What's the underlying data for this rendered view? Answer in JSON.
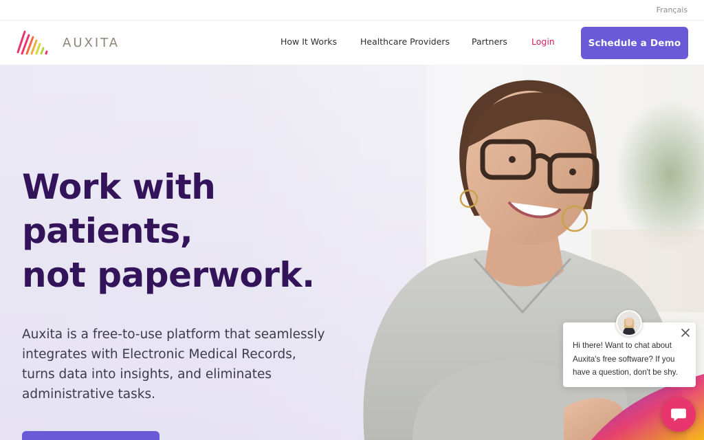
{
  "topbar": {
    "language_link": "Français"
  },
  "header": {
    "logo_text": "AUXITA",
    "nav": {
      "how_it_works": "How It Works",
      "healthcare_providers": "Healthcare Providers",
      "partners": "Partners",
      "login": "Login"
    },
    "demo_button": "Schedule a Demo"
  },
  "hero": {
    "headline_lines": [
      "Work with",
      "patients,",
      "not paperwork."
    ],
    "subtext_lines": [
      "Auxita is a free-to-use platform that seamlessly",
      "integrates with Electronic Medical Records,",
      "turns data into insights, and eliminates",
      "administrative tasks."
    ]
  },
  "chat": {
    "message_lines": [
      "Hi there! Want to chat about",
      "Auxita's free software? If you",
      "have a question, don't be shy."
    ]
  },
  "colors": {
    "brand_purple": "#6a5ad8",
    "headline": "#33145a",
    "login": "#d21d5c",
    "chat_launcher": "#e8356d"
  },
  "icons": {
    "logo": "auxita-stripes-logo",
    "chat_close": "close-icon",
    "chat_launcher": "chat-bubble-icon"
  }
}
